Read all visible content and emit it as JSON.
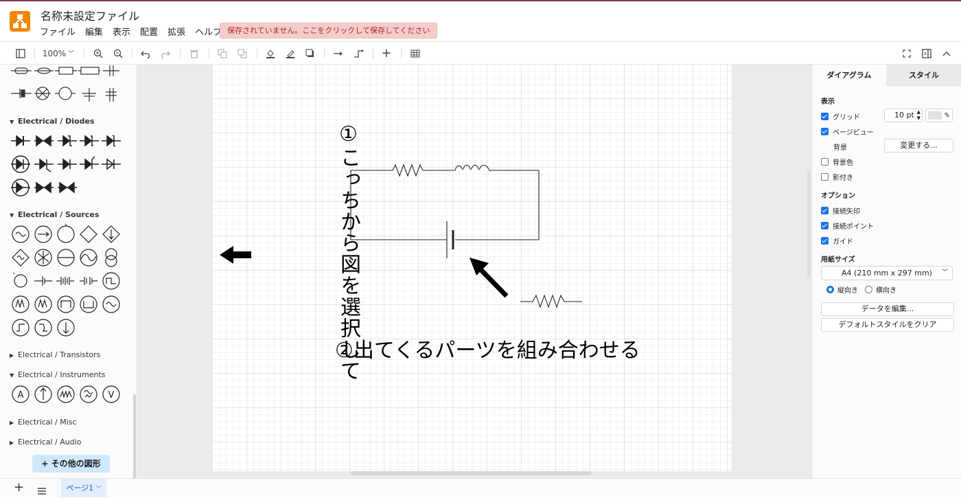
{
  "app": {
    "title": "名称未設定ファイル",
    "accent": "#f08705"
  },
  "menu": [
    "ファイル",
    "編集",
    "表示",
    "配置",
    "拡張",
    "ヘルプ"
  ],
  "warning": "保存されていません。ここをクリックして保存してください",
  "toolbar": {
    "zoom": "100%"
  },
  "sidebar": {
    "categories": [
      {
        "label": "Electrical / Diodes",
        "expanded": true
      },
      {
        "label": "Electrical / Sources",
        "expanded": true
      },
      {
        "label": "Electrical / Transistors",
        "expanded": false
      },
      {
        "label": "Electrical / Instruments",
        "expanded": true
      },
      {
        "label": "Electrical / Misc",
        "expanded": false
      },
      {
        "label": "Electrical / Audio",
        "expanded": false
      }
    ],
    "instrument_letters": [
      "A",
      "V"
    ],
    "more_shapes": "+ その他の図形"
  },
  "canvas": {
    "vertical_note": "①こっちから図を選択して",
    "horizontal_note": "②出てくるパーツを組み合わせる"
  },
  "right_panel": {
    "tabs": [
      "ダイアグラム",
      "スタイル"
    ],
    "view_heading": "表示",
    "grid_label": "グリッド",
    "grid_size": "10 pt",
    "page_view_label": "ページビュー",
    "background_label": "背景",
    "change_button": "変更する...",
    "background_color_label": "背景色",
    "shadow_label": "影付き",
    "options_heading": "オプション",
    "connection_arrows": "接続矢印",
    "connection_points": "接続ポイント",
    "guides": "ガイド",
    "paper_heading": "用紙サイズ",
    "paper_size": "A4 (210 mm x 297 mm)",
    "portrait": "縦向き",
    "landscape": "横向き",
    "edit_data": "データを編集...",
    "clear_style": "デフォルトスタイルをクリア",
    "checked": {
      "grid": true,
      "page_view": true,
      "background_color": false,
      "shadow": false,
      "connection_arrows": true,
      "connection_points": true,
      "guides": true
    }
  },
  "footer": {
    "page_tab": "ページ1"
  }
}
